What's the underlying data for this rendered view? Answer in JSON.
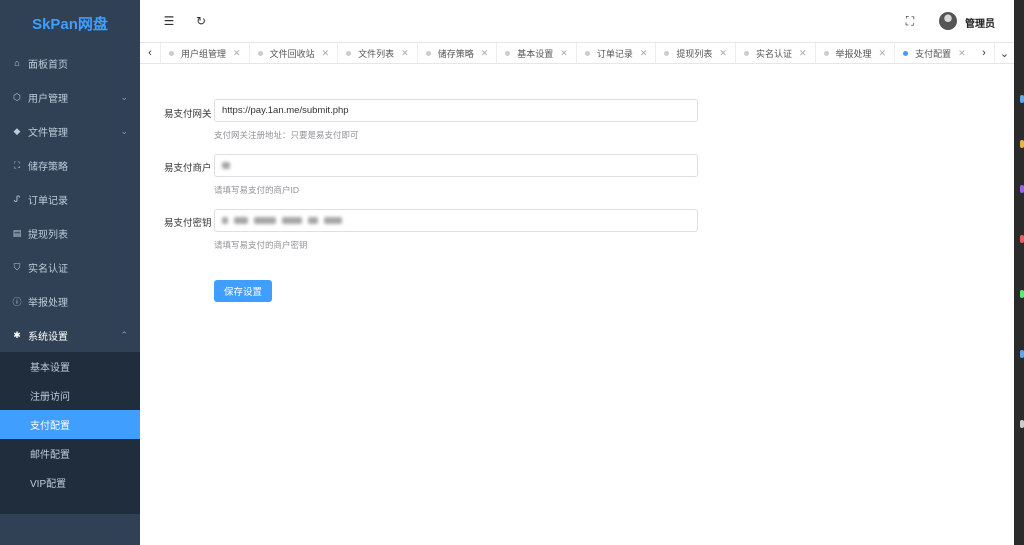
{
  "app": {
    "logo": "SkPan网盘"
  },
  "sidebar": {
    "items": [
      {
        "label": "面板首页",
        "icon": "home-icon"
      },
      {
        "label": "用户管理",
        "icon": "user-icon",
        "has_children": true
      },
      {
        "label": "文件管理",
        "icon": "folder-icon",
        "has_children": true
      },
      {
        "label": "储存策略",
        "icon": "storage-icon"
      },
      {
        "label": "订单记录",
        "icon": "order-icon"
      },
      {
        "label": "提现列表",
        "icon": "list-icon"
      },
      {
        "label": "实名认证",
        "icon": "shield-icon"
      },
      {
        "label": "举报处理",
        "icon": "report-icon"
      },
      {
        "label": "系统设置",
        "icon": "gear-icon",
        "has_children": true,
        "open": true
      }
    ],
    "submenu": [
      {
        "label": "基本设置"
      },
      {
        "label": "注册访问"
      },
      {
        "label": "支付配置",
        "active": true
      },
      {
        "label": "邮件配置"
      },
      {
        "label": "VIP配置"
      }
    ]
  },
  "header": {
    "user_name": "管理员"
  },
  "tabs": [
    {
      "label": "用户组管理"
    },
    {
      "label": "文件回收站"
    },
    {
      "label": "文件列表"
    },
    {
      "label": "储存策略"
    },
    {
      "label": "基本设置"
    },
    {
      "label": "订单记录"
    },
    {
      "label": "提现列表"
    },
    {
      "label": "实名认证"
    },
    {
      "label": "举报处理"
    },
    {
      "label": "支付配置",
      "active": true
    }
  ],
  "form": {
    "gateway": {
      "label": "易支付网关",
      "value": "https://pay.1an.me/submit.php",
      "hint": "支付网关注册地址：只要是易支付即可"
    },
    "merchant": {
      "label": "易支付商户",
      "hint": "请填写易支付的商户ID"
    },
    "secret": {
      "label": "易支付密钥",
      "hint": "请填写易支付的商户密钥"
    },
    "save_label": "保存设置"
  },
  "colors": {
    "accent": "#409eff",
    "sidebar_bg": "#304156",
    "submenu_bg": "#1f2d3d"
  }
}
